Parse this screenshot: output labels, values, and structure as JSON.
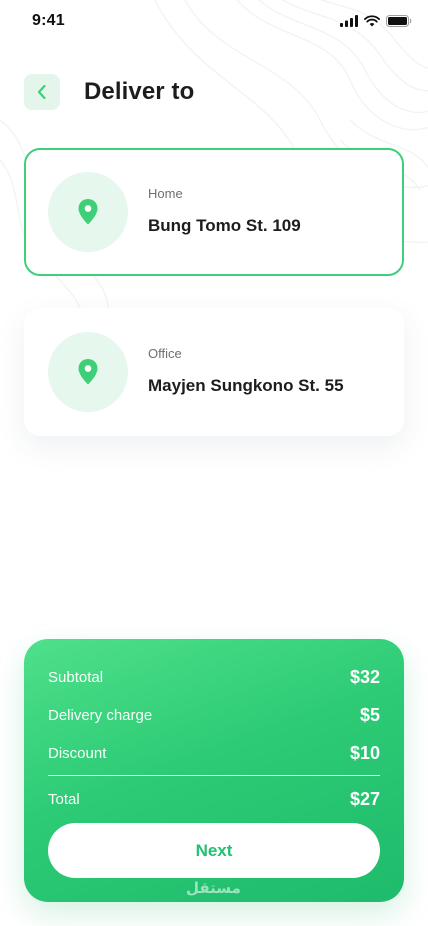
{
  "status_bar": {
    "time": "9:41",
    "icons": [
      "signal-icon",
      "wifi-icon",
      "battery-icon"
    ]
  },
  "header": {
    "back_icon": "chevron-left-icon",
    "title": "Deliver to"
  },
  "addresses": [
    {
      "label": "Home",
      "street": "Bung Tomo St. 109",
      "icon": "location-pin-icon",
      "selected": true
    },
    {
      "label": "Office",
      "street": "Mayjen Sungkono St. 55",
      "icon": "location-pin-icon",
      "selected": false
    }
  ],
  "summary": {
    "rows": [
      {
        "label": "Subtotal",
        "value": "$32"
      },
      {
        "label": "Delivery charge",
        "value": "$5"
      },
      {
        "label": "Discount",
        "value": "$10"
      }
    ],
    "total": {
      "label": "Total",
      "value": "$27"
    },
    "next_label": "Next",
    "watermark": "مستقل"
  },
  "colors": {
    "accent": "#3ecf78",
    "accent_dark": "#1dbb6b",
    "pin_bg": "#e6f7ee",
    "back_bg": "#e4f6ec",
    "text_primary": "#1b1e1d",
    "text_secondary": "#6c706e"
  }
}
